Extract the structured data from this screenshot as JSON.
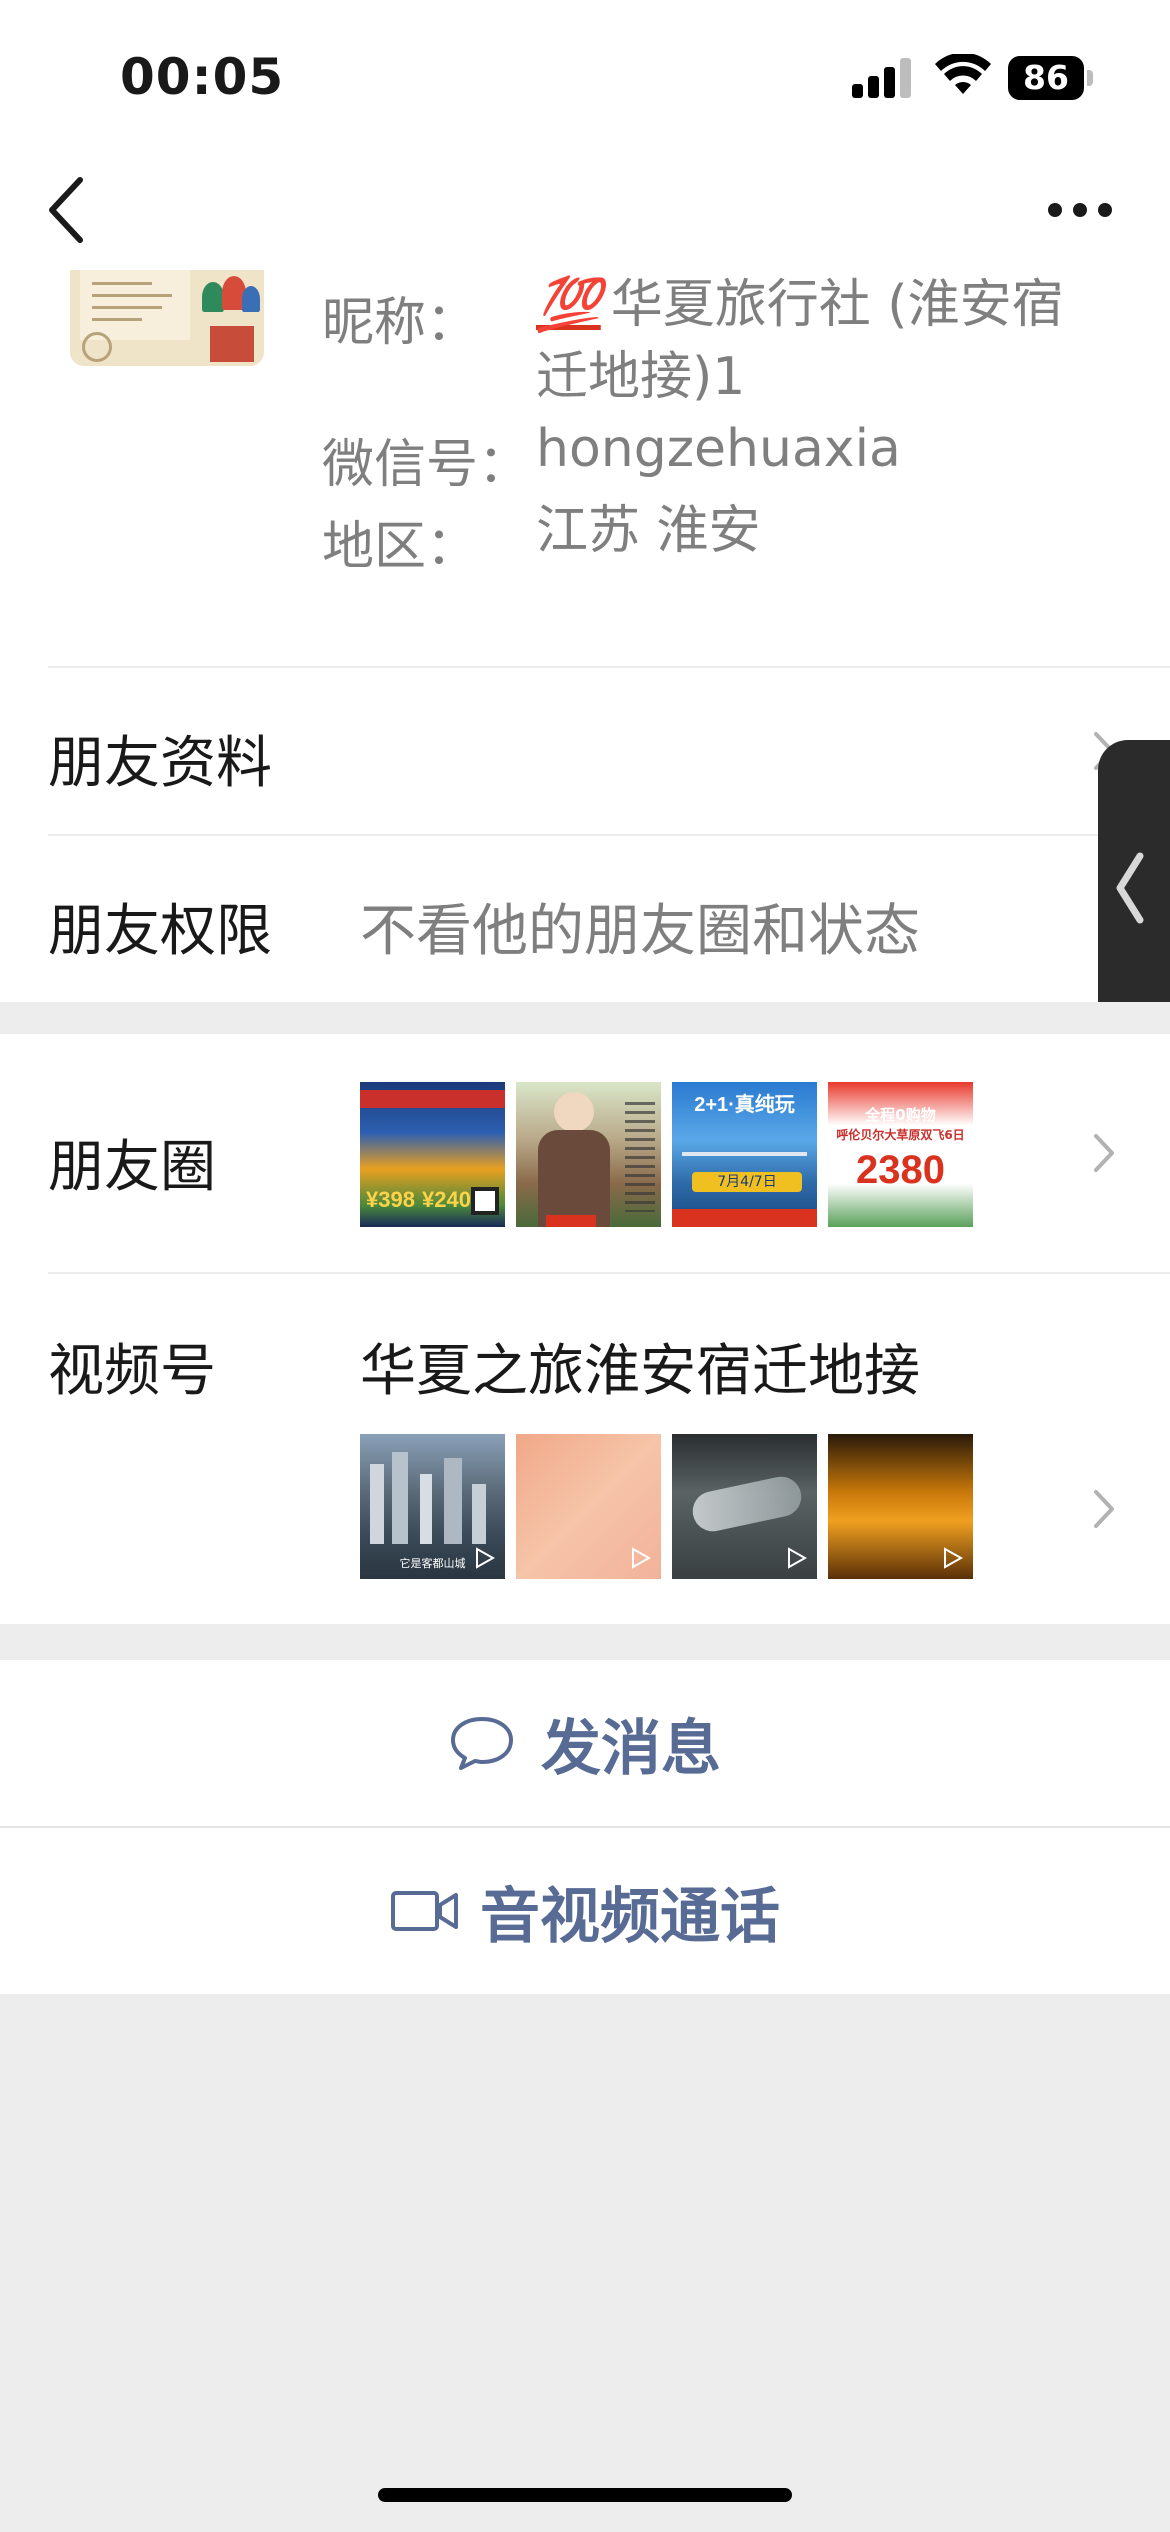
{
  "status_bar": {
    "time": "00:05",
    "battery": "86"
  },
  "profile": {
    "nickname_label": "昵称：",
    "nickname_emoji": "💯",
    "nickname_line1": "华夏旅行社 (淮安宿",
    "nickname_line2": "迁地接)1",
    "wechat_id_label": "微信号：",
    "wechat_id": "hongzehuaxia",
    "region_label": "地区：",
    "region": "江苏 淮安"
  },
  "rows": {
    "friend_info": "朋友资料",
    "friend_permission": "朋友权限",
    "friend_permission_value": "不看他的朋友圈和状态",
    "moments": "朋友圈",
    "channels": "视频号",
    "channels_name": "华夏之旅淮安宿迁地接"
  },
  "moments_thumbs": [
    {
      "price_a": "398",
      "price_b": "240"
    },
    {
      "text": ""
    },
    {
      "header": "2+1·真纯玩",
      "date": "7月4/7日"
    },
    {
      "tag": "全程0购物",
      "title": "呼伦贝尔大草原双飞6日",
      "price": "2380"
    }
  ],
  "channels_thumbs": [
    {
      "caption": "它是客都山城"
    },
    {
      "caption": ""
    },
    {
      "caption": ""
    },
    {
      "caption": ""
    }
  ],
  "actions": {
    "message": "发消息",
    "call": "音视频通话"
  },
  "colors": {
    "link_blue": "#576b95",
    "background": "#ededed",
    "accent_red": "#d9321f"
  }
}
